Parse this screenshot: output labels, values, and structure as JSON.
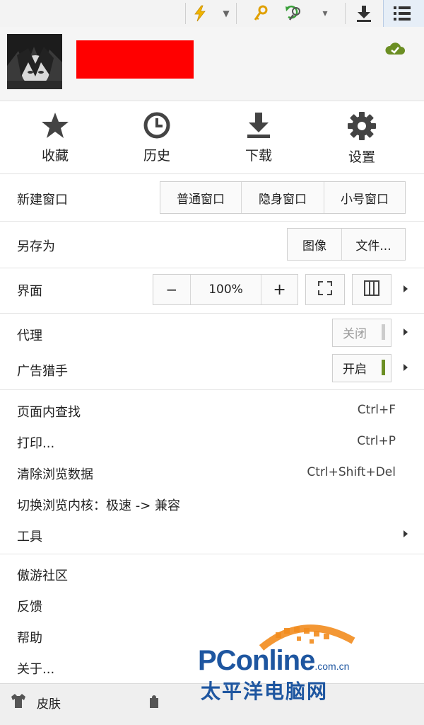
{
  "toolbar": {
    "icons": [
      "lightning-icon",
      "key-icon",
      "zoom-search-icon",
      "download-icon",
      "menu-list-icon"
    ]
  },
  "profile": {
    "sync_icon": "cloud-sync-icon"
  },
  "quick_actions": [
    {
      "label": "收藏",
      "icon": "star-icon"
    },
    {
      "label": "历史",
      "icon": "clock-icon"
    },
    {
      "label": "下载",
      "icon": "download-icon"
    },
    {
      "label": "设置",
      "icon": "gear-icon"
    }
  ],
  "new_window": {
    "label": "新建窗口",
    "options": [
      "普通窗口",
      "隐身窗口",
      "小号窗口"
    ]
  },
  "save_as": {
    "label": "另存为",
    "options": [
      "图像",
      "文件..."
    ]
  },
  "interface": {
    "label": "界面",
    "minus": "−",
    "zoom": "100%",
    "plus": "+"
  },
  "proxy": {
    "label": "代理",
    "state": "关闭",
    "state_color": "#cccccc"
  },
  "adblock": {
    "label": "广告猎手",
    "state": "开启",
    "state_color": "#6b8e23"
  },
  "menu_items": [
    {
      "label": "页面内查找",
      "shortcut": "Ctrl+F"
    },
    {
      "label": "打印...",
      "shortcut": "Ctrl+P"
    },
    {
      "label": "清除浏览数据",
      "shortcut": "Ctrl+Shift+Del"
    },
    {
      "label": "切换浏览内核：极速 -> 兼容",
      "shortcut": ""
    },
    {
      "label": "工具",
      "shortcut": ""
    }
  ],
  "more_items": [
    "傲游社区",
    "反馈",
    "帮助",
    "关于..."
  ],
  "footer": {
    "skin_label": "皮肤"
  },
  "watermark": {
    "brand_pc": "PC",
    "brand_online": "online",
    "domain": ".com.cn",
    "chinese": "太平洋电脑网",
    "colors": {
      "blue": "#1e56a0",
      "orange": "#f28c1e"
    }
  }
}
